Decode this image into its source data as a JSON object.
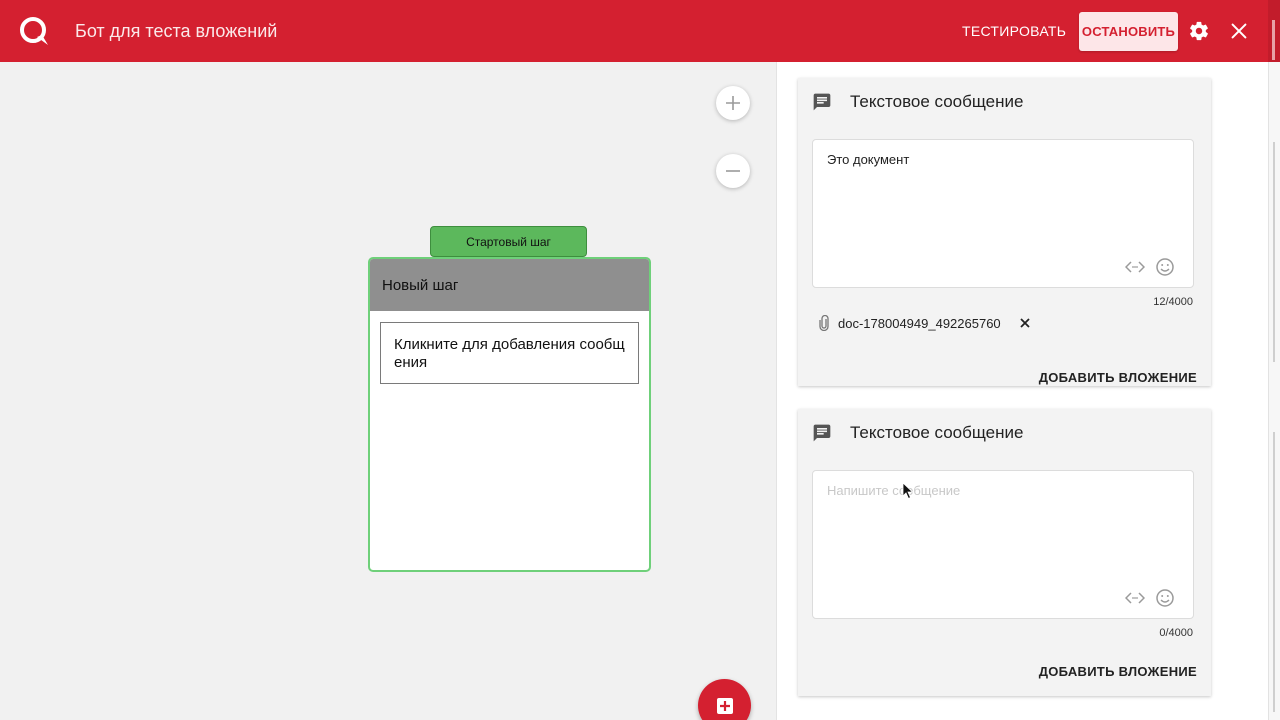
{
  "header": {
    "title": "Бот для теста вложений",
    "test_label": "ТЕСТИРОВАТЬ",
    "stop_label": "ОСТАНОВИТЬ",
    "bg_color": "#d42030"
  },
  "canvas": {
    "start_tag": "Стартовый шаг",
    "step_title": "Новый шаг",
    "step_message_prompt": "Кликните для добавления сообщения"
  },
  "panel": {
    "cards": [
      {
        "title": "Текстовое сообщение",
        "text": "Это документ",
        "counter": "12/4000",
        "attachment": "doc-178004949_492265760",
        "add_attachment": "ДОБАВИТЬ ВЛОЖЕНИЕ"
      },
      {
        "title": "Текстовое сообщение",
        "placeholder": "Напишите сообщение",
        "counter": "0/4000",
        "add_attachment": "ДОБАВИТЬ ВЛОЖЕНИЕ"
      }
    ]
  },
  "icons": [
    "logo-icon",
    "gear-icon",
    "close-icon",
    "zoom-in-icon",
    "zoom-out-icon",
    "message-icon",
    "code-icon",
    "emoji-icon",
    "paperclip-icon",
    "remove-icon",
    "add-step-icon"
  ]
}
